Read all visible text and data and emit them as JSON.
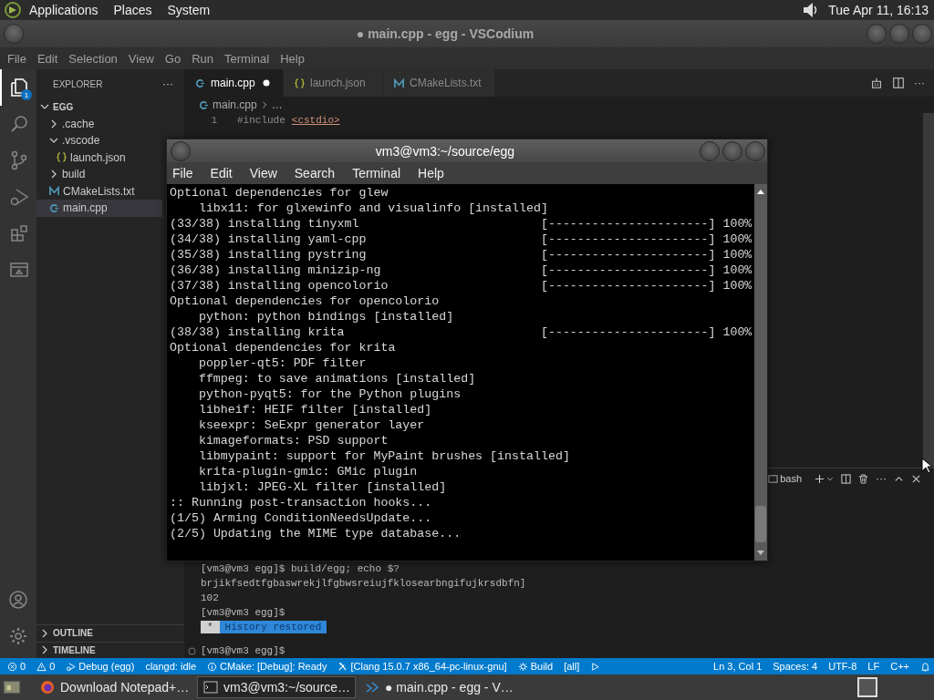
{
  "top_panel": {
    "menus": [
      "Applications",
      "Places",
      "System"
    ],
    "clock": "Tue Apr 11, 16:13"
  },
  "vscode": {
    "title": "● main.cpp - egg - VSCodium",
    "menu": [
      "File",
      "Edit",
      "Selection",
      "View",
      "Go",
      "Run",
      "Terminal",
      "Help"
    ],
    "activity_bar": [
      {
        "kind": "explorer",
        "selected": true,
        "badge": "1"
      },
      {
        "kind": "search",
        "selected": false
      },
      {
        "kind": "source-control",
        "selected": false
      },
      {
        "kind": "run-debug",
        "selected": false
      },
      {
        "kind": "extensions",
        "selected": false
      },
      {
        "kind": "remote",
        "selected": false
      }
    ],
    "sidebar": {
      "title": "EXPLORER",
      "more": "···",
      "root": {
        "label": "EGG",
        "expanded": true
      },
      "tree": [
        {
          "label": ".cache",
          "kind": "folder",
          "expanded": false,
          "selected": false
        },
        {
          "label": ".vscode",
          "kind": "folder",
          "expanded": true,
          "selected": false,
          "children": [
            {
              "label": "launch.json",
              "kind": "json",
              "selected": false
            }
          ]
        },
        {
          "label": "build",
          "kind": "folder",
          "expanded": false,
          "selected": false
        },
        {
          "label": "CMakeLists.txt",
          "kind": "cmake",
          "selected": false
        },
        {
          "label": "main.cpp",
          "kind": "cpp",
          "selected": true
        }
      ],
      "sections": [
        {
          "label": "OUTLINE",
          "expanded": false
        },
        {
          "label": "TIMELINE",
          "expanded": false
        }
      ]
    },
    "tabs": [
      {
        "label": "main.cpp",
        "kind": "cpp",
        "selected": true,
        "modified": true
      },
      {
        "label": "launch.json",
        "kind": "json",
        "selected": false
      },
      {
        "label": "CMakeLists.txt",
        "kind": "cmake",
        "selected": false
      }
    ],
    "breadcrumb": [
      "main.cpp",
      "…"
    ],
    "code": [
      {
        "number": "1",
        "directive": "#include",
        "header": "<cstdio>"
      }
    ],
    "panel": {
      "shell": "bash",
      "lines": [
        {
          "kind": "prompt",
          "text": "[vm3@vm3 egg]$ build/egg; echo $?"
        },
        {
          "kind": "output",
          "text": "brjikfsedtfgbaswrekjlfgbwsreiujfklosearbngifujkrsdbfn]"
        },
        {
          "kind": "output",
          "text": "102"
        },
        {
          "kind": "prompt",
          "text": "[vm3@vm3 egg]$"
        },
        {
          "kind": "banner",
          "mark": "*",
          "text": "History restored"
        },
        {
          "kind": "current",
          "text": "[vm3@vm3 egg]$"
        }
      ]
    },
    "status_left": [
      {
        "kind": "error",
        "text": "0"
      },
      {
        "kind": "warning",
        "text": "0"
      },
      {
        "kind": "debug",
        "text": "Debug (egg)"
      },
      {
        "kind": "plain",
        "text": "clangd: idle"
      },
      {
        "kind": "info",
        "text": "CMake: [Debug]: Ready"
      },
      {
        "kind": "tools",
        "text": "[Clang 15.0.7 x86_64-pc-linux-gnu]"
      },
      {
        "kind": "gear",
        "text": "Build"
      },
      {
        "kind": "plain",
        "text": "[all]"
      },
      {
        "kind": "play"
      }
    ],
    "status_right": [
      "Ln 3, Col 1",
      "Spaces: 4",
      "UTF-8",
      "LF",
      "C++"
    ]
  },
  "terminal_window": {
    "title": "vm3@vm3:~/source/egg",
    "menu": [
      "File",
      "Edit",
      "View",
      "Search",
      "Terminal",
      "Help"
    ],
    "lines": [
      {
        "kind": "plain",
        "text": "Optional dependencies for glew"
      },
      {
        "kind": "sub",
        "text": "libx11: for glxewinfo and visualinfo [installed]"
      },
      {
        "kind": "progress",
        "text": "(33/38) installing tinyxml",
        "bar": "[----------------------]",
        "percent": "100%"
      },
      {
        "kind": "progress",
        "text": "(34/38) installing yaml-cpp",
        "bar": "[----------------------]",
        "percent": "100%"
      },
      {
        "kind": "progress",
        "text": "(35/38) installing pystring",
        "bar": "[----------------------]",
        "percent": "100%"
      },
      {
        "kind": "progress",
        "text": "(36/38) installing minizip-ng",
        "bar": "[----------------------]",
        "percent": "100%"
      },
      {
        "kind": "progress",
        "text": "(37/38) installing opencolorio",
        "bar": "[----------------------]",
        "percent": "100%"
      },
      {
        "kind": "plain",
        "text": "Optional dependencies for opencolorio"
      },
      {
        "kind": "sub",
        "text": "python: python bindings [installed]"
      },
      {
        "kind": "progress",
        "text": "(38/38) installing krita",
        "bar": "[----------------------]",
        "percent": "100%"
      },
      {
        "kind": "plain",
        "text": "Optional dependencies for krita"
      },
      {
        "kind": "sub",
        "text": "poppler-qt5: PDF filter"
      },
      {
        "kind": "sub",
        "text": "ffmpeg: to save animations [installed]"
      },
      {
        "kind": "sub",
        "text": "python-pyqt5: for the Python plugins"
      },
      {
        "kind": "sub",
        "text": "libheif: HEIF filter [installed]"
      },
      {
        "kind": "sub",
        "text": "kseexpr: SeExpr generator layer"
      },
      {
        "kind": "sub",
        "text": "kimageformats: PSD support"
      },
      {
        "kind": "sub",
        "text": "libmypaint: support for MyPaint brushes [installed]"
      },
      {
        "kind": "sub",
        "text": "krita-plugin-gmic: GMic plugin"
      },
      {
        "kind": "sub",
        "text": "libjxl: JPEG-XL filter [installed]"
      },
      {
        "kind": "plain",
        "text": ":: Running post-transaction hooks..."
      },
      {
        "kind": "plain",
        "text": "(1/5) Arming ConditionNeedsUpdate..."
      },
      {
        "kind": "plain",
        "text": "(2/5) Updating the MIME type database..."
      }
    ]
  },
  "taskbar": [
    {
      "kind": "browser",
      "label": "Download Notepad+…",
      "selected": false
    },
    {
      "kind": "terminal",
      "label": "vm3@vm3:~/source…",
      "selected": true
    },
    {
      "kind": "editor",
      "label": "● main.cpp - egg - V…",
      "selected": false
    }
  ]
}
